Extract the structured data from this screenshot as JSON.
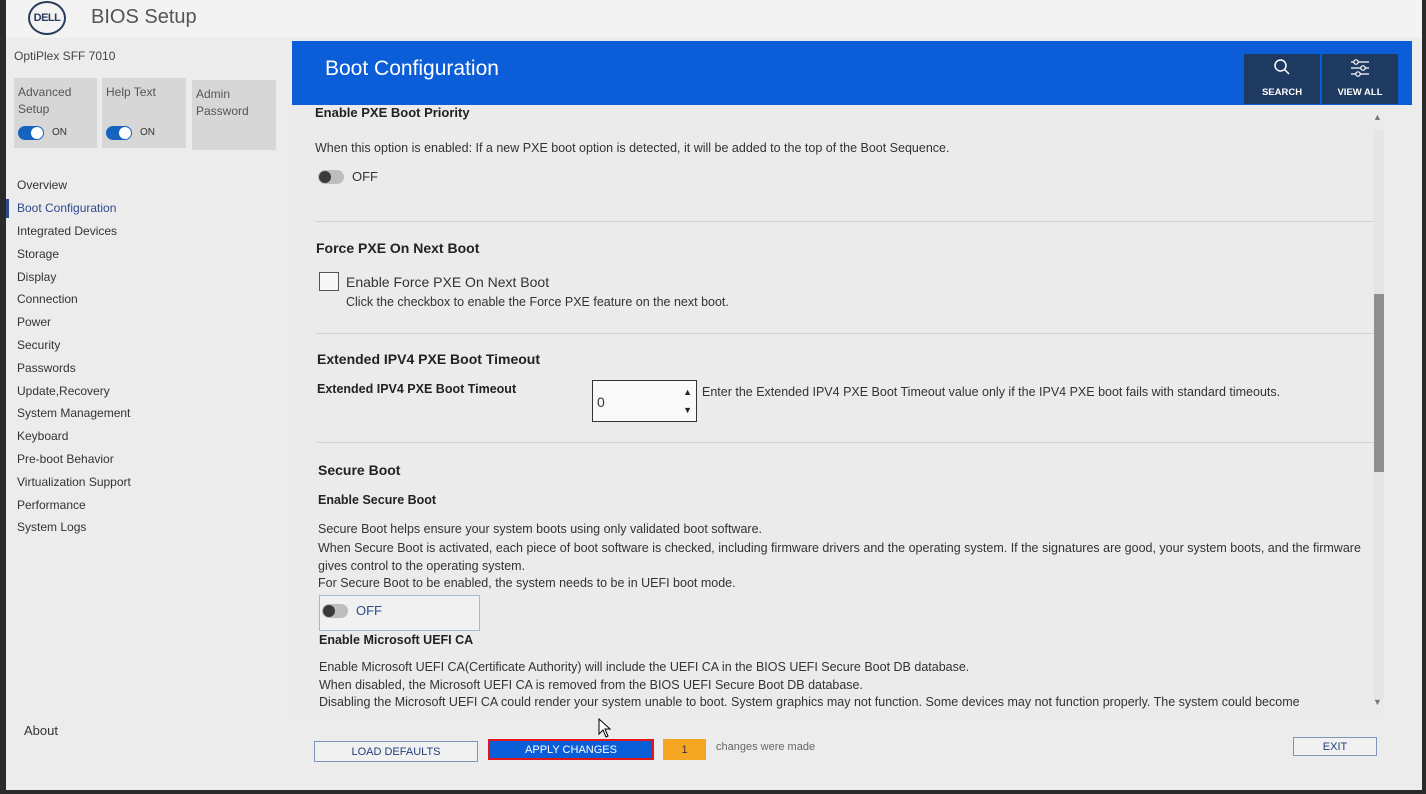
{
  "app": {
    "logo_text": "DELL",
    "title": "BIOS Setup"
  },
  "sidebar": {
    "model": "OptiPlex SFF 7010",
    "tiles": [
      {
        "label": "Advanced Setup",
        "toggle": "ON"
      },
      {
        "label": "Help Text",
        "toggle": "ON"
      },
      {
        "label": "Admin Password"
      }
    ],
    "items": [
      {
        "label": "Overview"
      },
      {
        "label": "Boot Configuration",
        "active": true
      },
      {
        "label": "Integrated Devices"
      },
      {
        "label": "Storage"
      },
      {
        "label": "Display"
      },
      {
        "label": "Connection"
      },
      {
        "label": "Power"
      },
      {
        "label": "Security"
      },
      {
        "label": "Passwords"
      },
      {
        "label": "Update,Recovery"
      },
      {
        "label": "System Management"
      },
      {
        "label": "Keyboard"
      },
      {
        "label": "Pre-boot Behavior"
      },
      {
        "label": "Virtualization Support"
      },
      {
        "label": "Performance"
      },
      {
        "label": "System Logs"
      }
    ],
    "about": "About"
  },
  "header": {
    "title": "Boot Configuration",
    "search_label": "SEARCH",
    "view_all_label": "VIEW ALL"
  },
  "sections": {
    "pxe_priority": {
      "title": "Enable PXE Boot Priority",
      "description": "When this option is enabled: If a new PXE boot option is detected, it will be added to the top of the Boot Sequence.",
      "toggle": "OFF"
    },
    "force_pxe": {
      "title": "Force PXE On Next Boot",
      "checkbox_label": "Enable Force PXE On Next Boot",
      "checkbox_help": "Click the checkbox to enable the Force PXE feature on the next boot."
    },
    "ipv4_timeout": {
      "title": "Extended IPV4 PXE Boot Timeout",
      "field_label": "Extended IPV4 PXE Boot Timeout",
      "value": "0",
      "help": "Enter the Extended IPV4 PXE Boot Timeout value only if the IPV4 PXE boot fails with standard timeouts."
    },
    "secure_boot": {
      "title": "Secure Boot",
      "subtitle": "Enable Secure Boot",
      "line1": "Secure Boot helps ensure your system boots using only validated boot software.",
      "line2": "When Secure Boot is activated, each piece of boot software is checked, including firmware drivers and the operating system. If the signatures are good, your system boots, and the firmware",
      "line3": "gives control to the operating system.",
      "line4": "For Secure Boot to be enabled, the system needs to be in UEFI boot mode.",
      "toggle": "OFF"
    },
    "ms_uefi": {
      "subtitle": "Enable Microsoft UEFI CA",
      "line1": "Enable Microsoft UEFI CA(Certificate Authority) will include the UEFI CA in the BIOS UEFI Secure Boot DB database.",
      "line2": "When disabled, the Microsoft UEFI CA is removed from the BIOS UEFI Secure Boot DB database.",
      "line3": "Disabling the Microsoft UEFI CA could render your system unable to boot. System graphics may not function. Some devices may not function properly. The system could become"
    }
  },
  "footer": {
    "load_defaults": "LOAD DEFAULTS",
    "apply_changes": "APPLY CHANGES",
    "changes_count": "1",
    "changes_text": "changes were made",
    "exit": "EXIT"
  },
  "colors": {
    "header_blue": "#0b5ed7",
    "header_button": "#1f3a60",
    "toggle_on": "#1565c0",
    "changes_badge": "#f5a623",
    "apply_outline": "#e0161c"
  }
}
